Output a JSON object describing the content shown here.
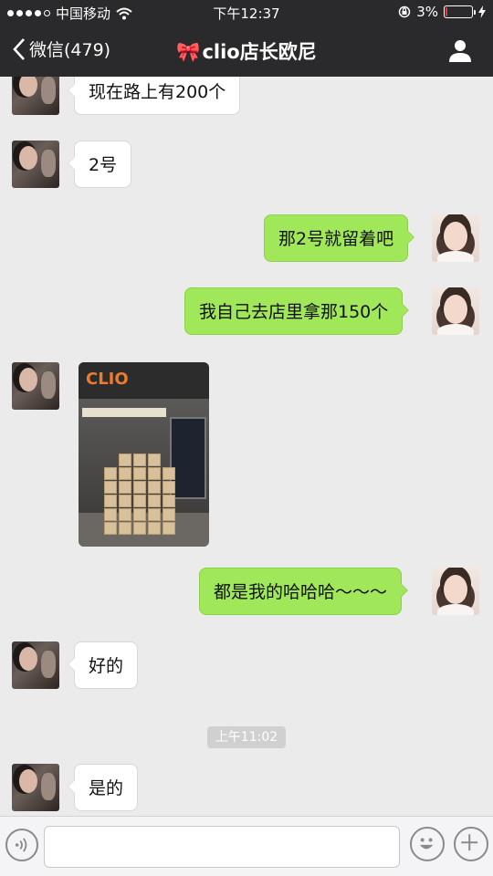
{
  "status_bar": {
    "carrier": "中国移动",
    "time": "下午12:37",
    "battery_percent": "3%",
    "battery_level": 0.03
  },
  "nav": {
    "back_label": "微信(479)",
    "title_emoji": "🎀",
    "title": "clio店长欧尼"
  },
  "messages": [
    {
      "side": "other",
      "text": "现在路上有200个"
    },
    {
      "side": "other",
      "text": "2号"
    },
    {
      "side": "me",
      "text": "那2号就留着吧"
    },
    {
      "side": "me",
      "text": "我自己去店里拿那150个"
    },
    {
      "side": "other",
      "type": "image",
      "image_sign_text": "CLIO"
    },
    {
      "side": "me",
      "text": "都是我的哈哈哈～～～"
    },
    {
      "side": "other",
      "text": "好的"
    },
    {
      "side": "system",
      "text": "上午11:02"
    },
    {
      "side": "other",
      "text": "是的"
    }
  ],
  "input_bar": {
    "placeholder": ""
  },
  "colors": {
    "nav_bg": "#2a2a2c",
    "chat_bg": "#ebebeb",
    "my_bubble": "#a0e75a",
    "their_bubble": "#ffffff",
    "battery_low": "#e63a3a"
  }
}
